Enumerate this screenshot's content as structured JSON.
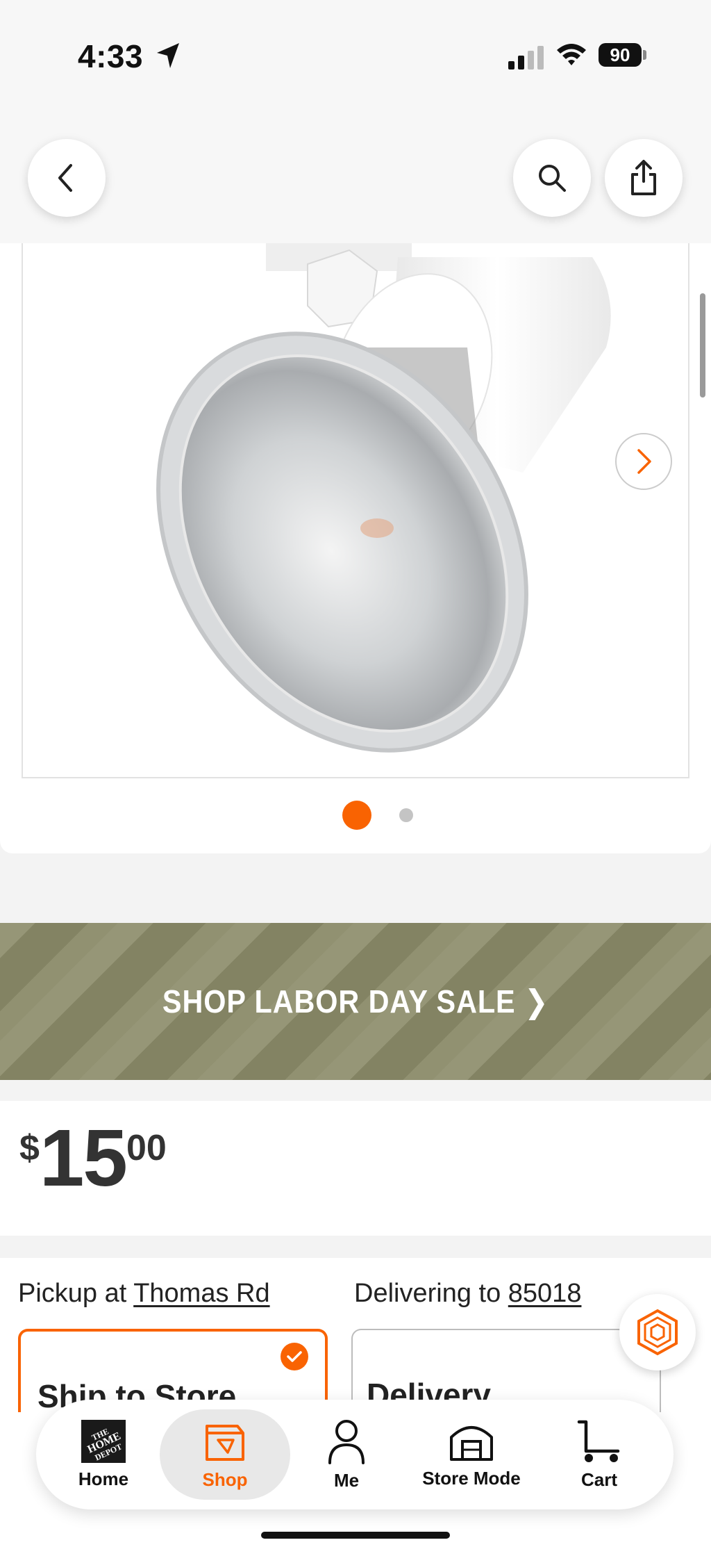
{
  "status_bar": {
    "time": "4:33",
    "battery": "90"
  },
  "header": {
    "back_icon": "chevron-left-icon",
    "search_icon": "search-icon",
    "share_icon": "share-icon"
  },
  "gallery": {
    "image_alt": "track light head product image",
    "image_count": 2,
    "active_index": 0,
    "next_icon": "chevron-right-icon",
    "accent_color": "#f96302"
  },
  "promo": {
    "label": "SHOP LABOR DAY SALE ❯"
  },
  "price": {
    "currency": "$",
    "dollars": "15",
    "cents": "00"
  },
  "fulfillment": {
    "pickup_prefix": "Pickup at",
    "pickup_store": "Thomas Rd",
    "delivery_prefix": "Delivering to",
    "delivery_zip": "85018",
    "options": [
      {
        "title": "Ship to Store",
        "selected": true
      },
      {
        "title": "Delivery",
        "selected": false
      }
    ]
  },
  "tab_bar": {
    "tabs": [
      {
        "label": "Home",
        "icon": "home-depot-logo-icon",
        "active": false
      },
      {
        "label": "Shop",
        "icon": "shop-bag-icon",
        "active": true
      },
      {
        "label": "Me",
        "icon": "person-icon",
        "active": false
      },
      {
        "label": "Store Mode",
        "icon": "store-icon",
        "active": false
      },
      {
        "label": "Cart",
        "icon": "cart-icon",
        "active": false
      }
    ]
  }
}
